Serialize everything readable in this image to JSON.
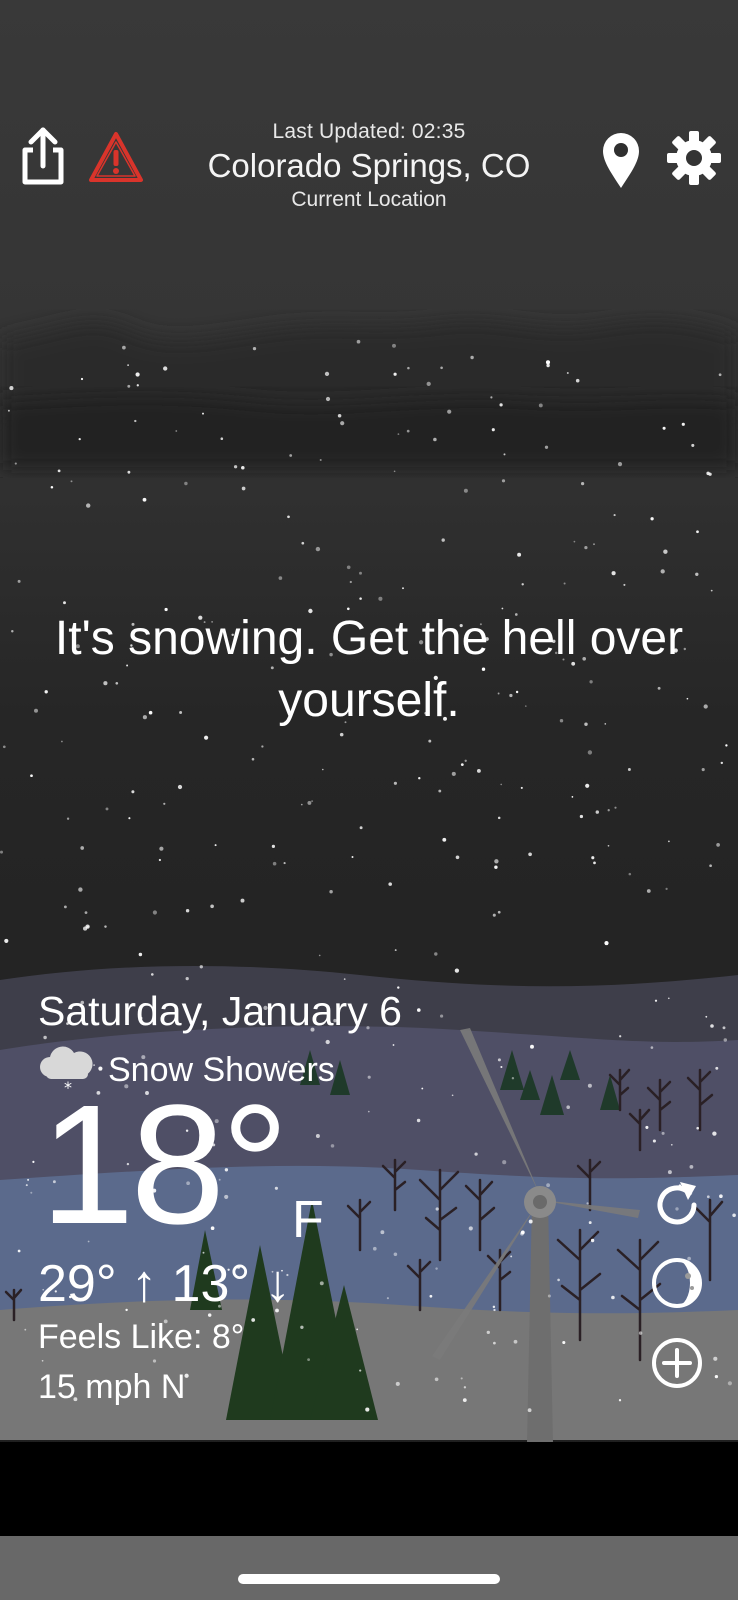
{
  "header": {
    "last_updated": "Last Updated: 02:35",
    "city": "Colorado Springs, CO",
    "location_label": "Current Location",
    "icons": [
      "share-icon",
      "alert-triangle-icon",
      "map-pin-icon",
      "gear-icon"
    ]
  },
  "message": "It's snowing. Get the hell over yourself.",
  "weather": {
    "date": "Saturday, January 6",
    "condition": "Snow Showers",
    "condition_icon": "snow-cloud-icon",
    "temperature": "18°",
    "unit": "F",
    "high_low": "29° ↑ 13° ↓",
    "feels_like": "Feels Like: 8°",
    "wind": "15 mph N"
  },
  "actions": {
    "icons": [
      "refresh-icon",
      "moon-phase-icon",
      "add-circle-icon"
    ]
  },
  "colors": {
    "sky_top": "#3a3a3a",
    "sky_bottom": "#1f1f1f",
    "alert_red": "#d9342b",
    "hills_purple": "#4f4f66",
    "hills_blue": "#5b6a8c",
    "snow_ground": "#777777",
    "tree_dark": "#1f3a1e"
  }
}
